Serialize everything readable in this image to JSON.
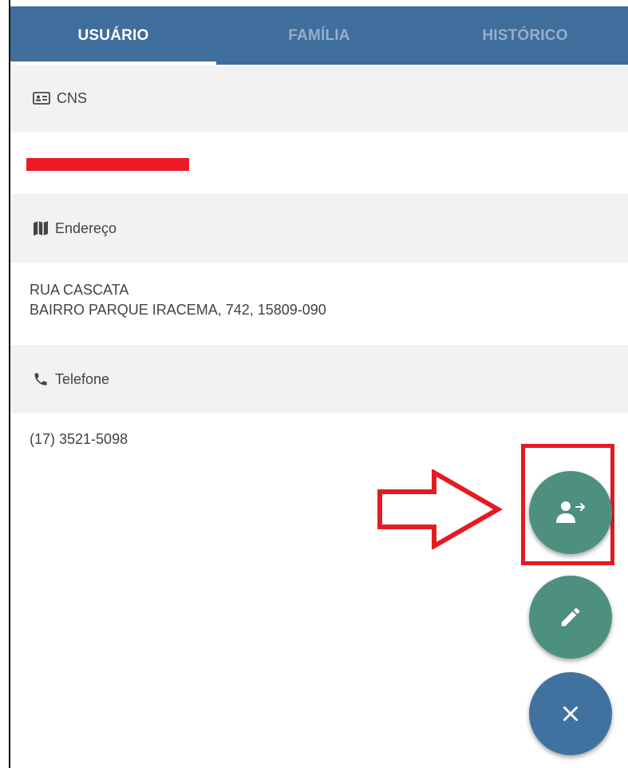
{
  "tabs": [
    {
      "label": "USUÁRIO",
      "active": true
    },
    {
      "label": "FAMÍLIA",
      "active": false
    },
    {
      "label": "HISTÓRICO",
      "active": false
    }
  ],
  "sections": {
    "cns": {
      "label": "CNS",
      "icon": "id-card-icon"
    },
    "endereco": {
      "label": "Endereço",
      "icon": "map-icon",
      "line1": "RUA CASCATA",
      "line2": "BAIRRO PARQUE IRACEMA, 742, 15809-090"
    },
    "telefone": {
      "label": "Telefone",
      "icon": "phone-icon",
      "value": "(17) 3521-5098"
    }
  },
  "fabs": [
    {
      "name": "transfer-user",
      "icon": "person-arrow-icon",
      "color": "#4e9080"
    },
    {
      "name": "edit",
      "icon": "pencil-icon",
      "color": "#4e9080"
    },
    {
      "name": "close",
      "icon": "close-icon",
      "color": "#41729f"
    }
  ],
  "colors": {
    "tabbar": "#3f6d9c",
    "annotation": "#e31b23",
    "redaction": "#ea1b24"
  }
}
